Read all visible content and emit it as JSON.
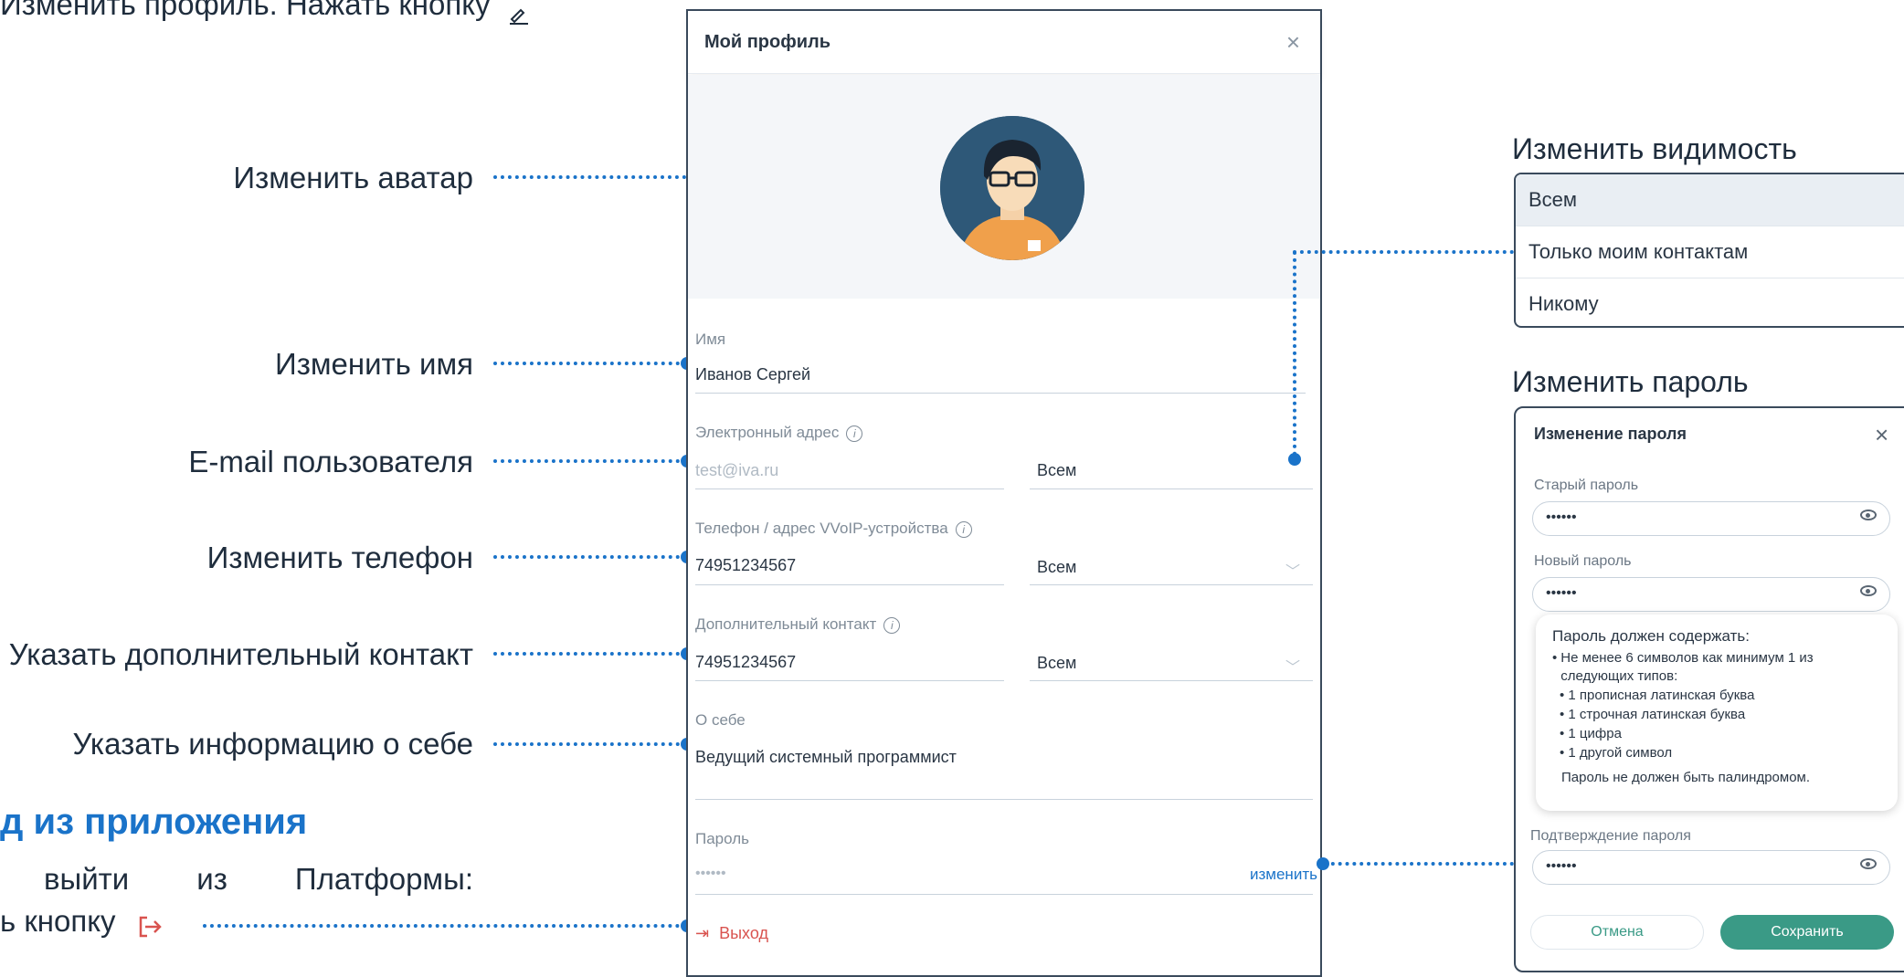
{
  "top_text": "Изменить профиль. Нажать кнопку",
  "callouts": {
    "avatar": "Изменить аватар",
    "name": "Изменить имя",
    "email": "E-mail пользователя",
    "phone": "Изменить телефон",
    "extra_contact": "Указать дополнительный контакт",
    "about": "Указать информацию о себе"
  },
  "logout_section": {
    "heading": "д из приложения",
    "line1": "выйти из Платформы:",
    "line2": "ь кнопку"
  },
  "profile_dialog": {
    "title": "Мой профиль",
    "fields": {
      "name_label": "Имя",
      "name_value": "Иванов Сергей",
      "email_label": "Электронный адрес",
      "email_placeholder": "test@iva.ru",
      "email_visibility": "Всем",
      "phone_label": "Телефон / адрес VVoIP-устройства",
      "phone_value": "74951234567",
      "phone_visibility": "Всем",
      "extra_label": "Дополнительный контакт",
      "extra_value": "74951234567",
      "extra_visibility": "Всем",
      "about_label": "О себе",
      "about_value": "Ведущий системный программист",
      "password_label": "Пароль",
      "password_value": "••••••",
      "password_change": "изменить",
      "logout": "Выход"
    }
  },
  "visibility_panel": {
    "heading": "Изменить видимость",
    "options": [
      "Всем",
      "Только моим контактам",
      "Никому"
    ]
  },
  "password_panel": {
    "heading": "Изменить пароль",
    "title": "Изменение пароля",
    "old_label": "Старый пароль",
    "old_value": "••••••",
    "new_label": "Новый пароль",
    "new_value": "••••••",
    "rules_title": "Пароль должен содержать:",
    "rules_main": "Не менее 6 символов как минимум 1 из следующих типов:",
    "rules_items": [
      "1 прописная латинская буква",
      "1 строчная латинская буква",
      "1 цифра",
      "1 другой символ"
    ],
    "rules_footer": "Пароль не должен быть палиндромом.",
    "confirm_label": "Подтверждение пароля",
    "confirm_value": "••••••",
    "cancel": "Отмена",
    "save": "Сохранить"
  },
  "colors": {
    "accent_blue": "#1a73c9",
    "save_green": "#3a9a86",
    "logout_red": "#d9534f"
  }
}
